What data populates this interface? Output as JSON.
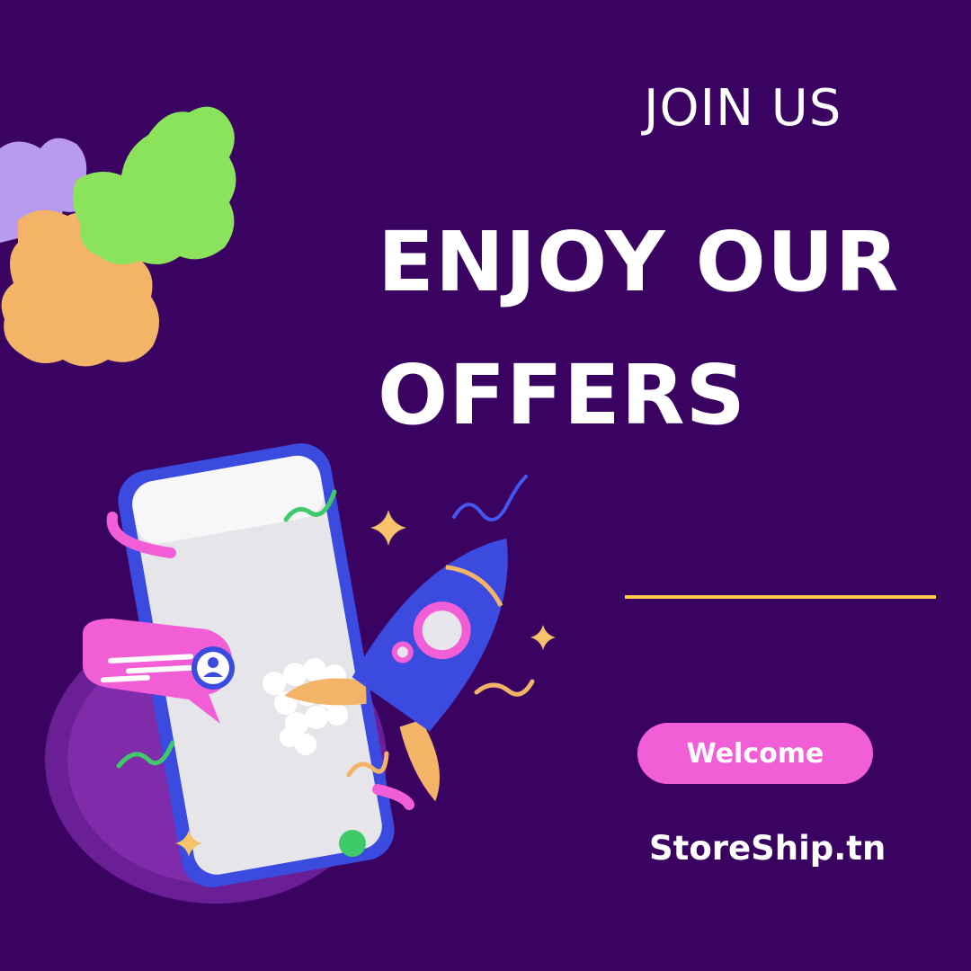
{
  "join_label": "JOIN US",
  "headline": {
    "line1": "ENJOY OUR",
    "line2": "OFFERS"
  },
  "button": {
    "label": "Welcome"
  },
  "site": "StoreShip.tn",
  "colors": {
    "background": "#3a0361",
    "accent_pink": "#f25ed5",
    "rule_yellow": "#f8c94d",
    "text": "#ffffff"
  },
  "icons": [
    "puzzle-pieces-illustration",
    "smartphone-illustration",
    "rocket-illustration",
    "chat-bubble-icon",
    "user-avatar-icon",
    "sparkle-icon"
  ]
}
